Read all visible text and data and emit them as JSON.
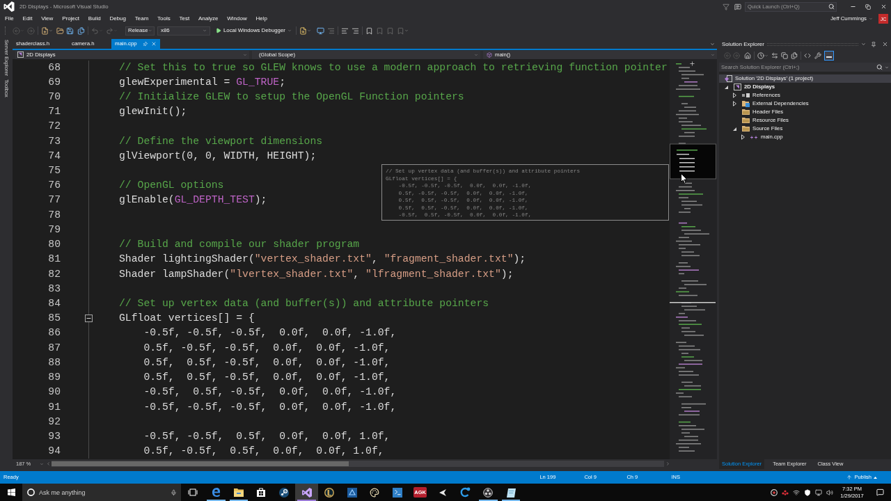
{
  "title_bar": {
    "title": "2D Displays - Microsoft Visual Studio",
    "quick_launch": {
      "placeholder": "Quick Launch (Ctrl+Q)"
    }
  },
  "menu_bar": {
    "items": [
      "File",
      "Edit",
      "View",
      "Project",
      "Build",
      "Debug",
      "Team",
      "Tools",
      "Test",
      "Analyze",
      "Window",
      "Help"
    ],
    "account": {
      "name": "Jeff Cummings",
      "initials": "JC"
    }
  },
  "toolbar": {
    "configuration": "Release",
    "platform": "x86",
    "start_debugger": "Local Windows Debugger"
  },
  "side_tabs": [
    "Server Explorer",
    "Toolbox"
  ],
  "document_tabs": [
    {
      "label": "shaderclass.h",
      "selected": false
    },
    {
      "label": "camera.h",
      "selected": false
    },
    {
      "label": "main.cpp",
      "selected": true
    }
  ],
  "navigation_bar": {
    "project": "2D Displays",
    "scope": "(Global Scope)",
    "member": "main()"
  },
  "editor": {
    "lines": [
      {
        "number": "68",
        "segments": [
          {
            "kind": "comment",
            "text": "// Set this to true so GLEW knows to use a modern approach to retrieving function pointer"
          }
        ]
      },
      {
        "number": "69",
        "segments": [
          {
            "kind": "plain",
            "text": "glewExperimental = "
          },
          {
            "kind": "macro",
            "text": "GL_TRUE"
          },
          {
            "kind": "plain",
            "text": ";"
          }
        ]
      },
      {
        "number": "70",
        "segments": [
          {
            "kind": "comment",
            "text": "// Initialize GLEW to setup the OpenGL Function pointers"
          }
        ]
      },
      {
        "number": "71",
        "segments": [
          {
            "kind": "plain",
            "text": "glewInit();"
          }
        ]
      },
      {
        "number": "72"
      },
      {
        "number": "73",
        "segments": [
          {
            "kind": "comment",
            "text": "// Define the viewport dimensions"
          }
        ]
      },
      {
        "number": "74",
        "segments": [
          {
            "kind": "plain",
            "text": "glViewport(0, 0, WIDTH, HEIGHT);"
          }
        ]
      },
      {
        "number": "75"
      },
      {
        "number": "76",
        "segments": [
          {
            "kind": "comment",
            "text": "// OpenGL options"
          }
        ]
      },
      {
        "number": "77",
        "segments": [
          {
            "kind": "plain",
            "text": "glEnable("
          },
          {
            "kind": "macro",
            "text": "GL_DEPTH_TEST"
          },
          {
            "kind": "plain",
            "text": ");"
          }
        ]
      },
      {
        "number": "78"
      },
      {
        "number": "79"
      },
      {
        "number": "80",
        "segments": [
          {
            "kind": "comment",
            "text": "// Build and compile our shader program"
          }
        ]
      },
      {
        "number": "81",
        "segments": [
          {
            "kind": "plain",
            "text": "Shader lightingShader("
          },
          {
            "kind": "string",
            "text": "\"vertex_shader.txt\""
          },
          {
            "kind": "plain",
            "text": ", "
          },
          {
            "kind": "string",
            "text": "\"fragment_shader.txt\""
          },
          {
            "kind": "plain",
            "text": ");"
          }
        ]
      },
      {
        "number": "82",
        "segments": [
          {
            "kind": "plain",
            "text": "Shader lampShader("
          },
          {
            "kind": "string",
            "text": "\"lvertex_shader.txt\""
          },
          {
            "kind": "plain",
            "text": ", "
          },
          {
            "kind": "string",
            "text": "\"lfragment_shader.txt\""
          },
          {
            "kind": "plain",
            "text": ");"
          }
        ]
      },
      {
        "number": "83"
      },
      {
        "number": "84",
        "segments": [
          {
            "kind": "comment",
            "text": "// Set up vertex data (and buffer(s)) and attribute pointers"
          }
        ]
      },
      {
        "number": "85",
        "fold_expanded": true,
        "segments": [
          {
            "kind": "plain",
            "text": "GLfloat vertices[] = {"
          }
        ]
      },
      {
        "number": "86",
        "segments": [
          {
            "kind": "plain",
            "text": "    -0.5f, -0.5f, -0.5f,  0.0f,  0.0f, -1.0f,"
          }
        ]
      },
      {
        "number": "87",
        "segments": [
          {
            "kind": "plain",
            "text": "    0.5f, -0.5f, -0.5f,  0.0f,  0.0f, -1.0f,"
          }
        ]
      },
      {
        "number": "88",
        "segments": [
          {
            "kind": "plain",
            "text": "    0.5f,  0.5f, -0.5f,  0.0f,  0.0f, -1.0f,"
          }
        ]
      },
      {
        "number": "89",
        "segments": [
          {
            "kind": "plain",
            "text": "    0.5f,  0.5f, -0.5f,  0.0f,  0.0f, -1.0f,"
          }
        ]
      },
      {
        "number": "90",
        "segments": [
          {
            "kind": "plain",
            "text": "    -0.5f,  0.5f, -0.5f,  0.0f,  0.0f, -1.0f,"
          }
        ]
      },
      {
        "number": "91",
        "segments": [
          {
            "kind": "plain",
            "text": "    -0.5f, -0.5f, -0.5f,  0.0f,  0.0f, -1.0f,"
          }
        ]
      },
      {
        "number": "92"
      },
      {
        "number": "93",
        "segments": [
          {
            "kind": "plain",
            "text": "    -0.5f, -0.5f,  0.5f,  0.0f,  0.0f, 1.0f,"
          }
        ]
      },
      {
        "number": "94",
        "segments": [
          {
            "kind": "plain",
            "text": "    0.5f, -0.5f,  0.5f,  0.0f,  0.0f, 1.0f,"
          }
        ]
      }
    ],
    "hover_preview": {
      "lines": [
        "// Set up vertex data (and buffer(s)) and attribute pointers",
        "GLfloat vertices[] = {",
        "    -0.5f, -0.5f, -0.5f,  0.0f,  0.0f, -1.0f,",
        "    0.5f, -0.5f, -0.5f,  0.0f,  0.0f, -1.0f,",
        "    0.5f,  0.5f, -0.5f,  0.0f,  0.0f, -1.0f,",
        "    0.5f,  0.5f, -0.5f,  0.0f,  0.0f, -1.0f,",
        "    -0.5f,  0.5f, -0.5f,  0.0f,  0.0f, -1.0f,"
      ]
    },
    "zoom": "187 %"
  },
  "solution_explorer": {
    "title": "Solution Explorer",
    "toolbar_toggle_on": true,
    "search": {
      "placeholder": "Search Solution Explorer (Ctrl+;)"
    },
    "tree": [
      {
        "label": "Solution '2D Displays' (1 project)",
        "kind": "solution",
        "selected": true,
        "children": [
          {
            "label": "2D Displays",
            "kind": "project",
            "selected": false,
            "expanded": true,
            "children": [
              {
                "label": "References",
                "kind": "references",
                "selected": false,
                "expanded": false
              },
              {
                "label": "External Dependencies",
                "kind": "external",
                "selected": false,
                "expanded": false
              },
              {
                "label": "Header Files",
                "kind": "folder",
                "selected": false
              },
              {
                "label": "Resource Files",
                "kind": "folder",
                "selected": false
              },
              {
                "label": "Source Files",
                "kind": "folder",
                "selected": false,
                "expanded": true,
                "children": [
                  {
                    "label": "main.cpp",
                    "kind": "cpp",
                    "selected": false,
                    "expanded": false
                  }
                ]
              }
            ]
          }
        ]
      }
    ],
    "bottom_tabs": [
      {
        "label": "Solution Explorer",
        "selected": true
      },
      {
        "label": "Team Explorer",
        "selected": false
      },
      {
        "label": "Class View",
        "selected": false
      }
    ]
  },
  "status_bar": {
    "message": "Ready",
    "line": "Ln 199",
    "column": "Col 9",
    "character": "Ch 9",
    "mode": "INS",
    "publish": "Publish"
  },
  "taskbar": {
    "search": {
      "placeholder": "Ask me anything"
    },
    "apps": [
      {
        "kind": "browser",
        "running": true,
        "selected": false
      },
      {
        "kind": "folder",
        "running": true,
        "selected": false
      },
      {
        "kind": "store",
        "running": false,
        "selected": false
      },
      {
        "kind": "steam",
        "running": false,
        "selected": false
      },
      {
        "kind": "visual_studio",
        "running": true,
        "selected": true
      },
      {
        "kind": "league",
        "running": false,
        "selected": false
      },
      {
        "kind": "blue_app",
        "running": false,
        "selected": false
      },
      {
        "kind": "paint",
        "running": false,
        "selected": false
      },
      {
        "kind": "terminal",
        "running": false,
        "selected": false
      },
      {
        "kind": "agk",
        "label": "AGK",
        "running": false,
        "selected": false
      },
      {
        "kind": "arrow",
        "running": false,
        "selected": false
      },
      {
        "kind": "cleaner",
        "running": false,
        "selected": false
      },
      {
        "kind": "obs",
        "running": true,
        "selected": false
      },
      {
        "kind": "notepad",
        "running": true,
        "selected": false
      }
    ],
    "clock": {
      "time": "7:32 PM",
      "date": "1/29/2017"
    }
  }
}
